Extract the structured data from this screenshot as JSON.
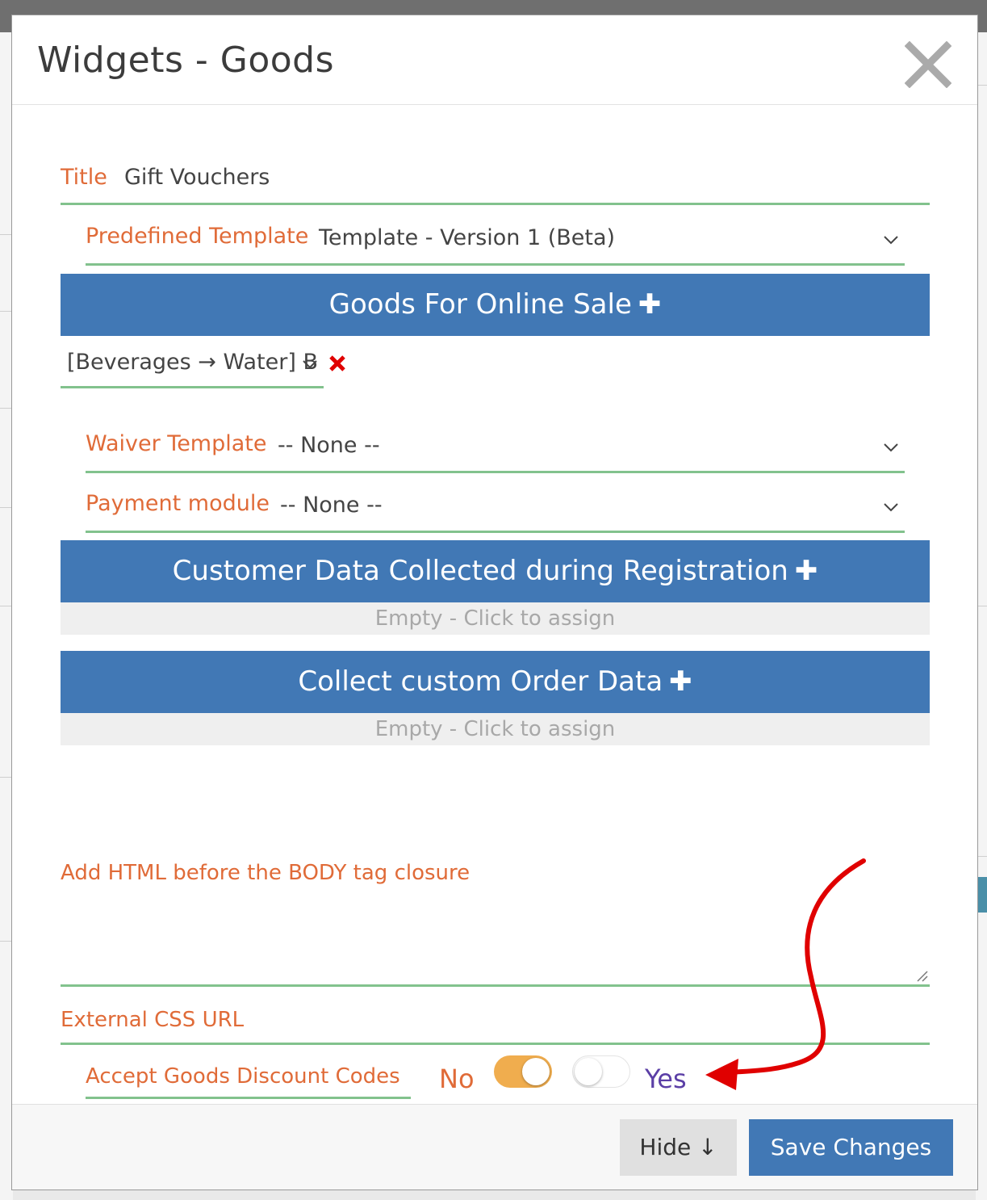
{
  "modal": {
    "title": "Widgets - Goods"
  },
  "fields": {
    "title_label": "Title",
    "title_value": "Gift Vouchers",
    "template_label": "Predefined Template",
    "template_value": "Template - Version 1 (Beta)",
    "goods_item_value": "[Beverages → Water] B",
    "waiver_label": "Waiver Template",
    "waiver_value": "-- None --",
    "payment_label": "Payment module",
    "payment_value": "-- None --",
    "html_label": "Add HTML before the BODY tag closure",
    "css_label": "External CSS URL",
    "discount_label": "Accept Goods Discount Codes",
    "discount_no": "No",
    "discount_yes": "Yes"
  },
  "sections": {
    "goods": "Goods For Online Sale",
    "customer_data": "Customer Data Collected during Registration",
    "customer_data_empty": "Empty - Click to assign",
    "order_data": "Collect custom Order Data",
    "order_data_empty": "Empty - Click to assign",
    "plus_glyph": "✚"
  },
  "footer": {
    "hide_label": "Hide ↓",
    "save_label": "Save Changes"
  },
  "colors": {
    "accent_blue": "#4178b5",
    "label_orange": "#e06b38",
    "underline_green": "#82c28d",
    "toggle_orange": "#f0ad4e",
    "yes_purple": "#5b3fa6",
    "annotation_red": "#e00000"
  },
  "icons": [
    "close-icon",
    "chevron-down-icon",
    "remove-x-icon",
    "plus-icon",
    "resize-grip-icon",
    "annotation-arrow"
  ]
}
